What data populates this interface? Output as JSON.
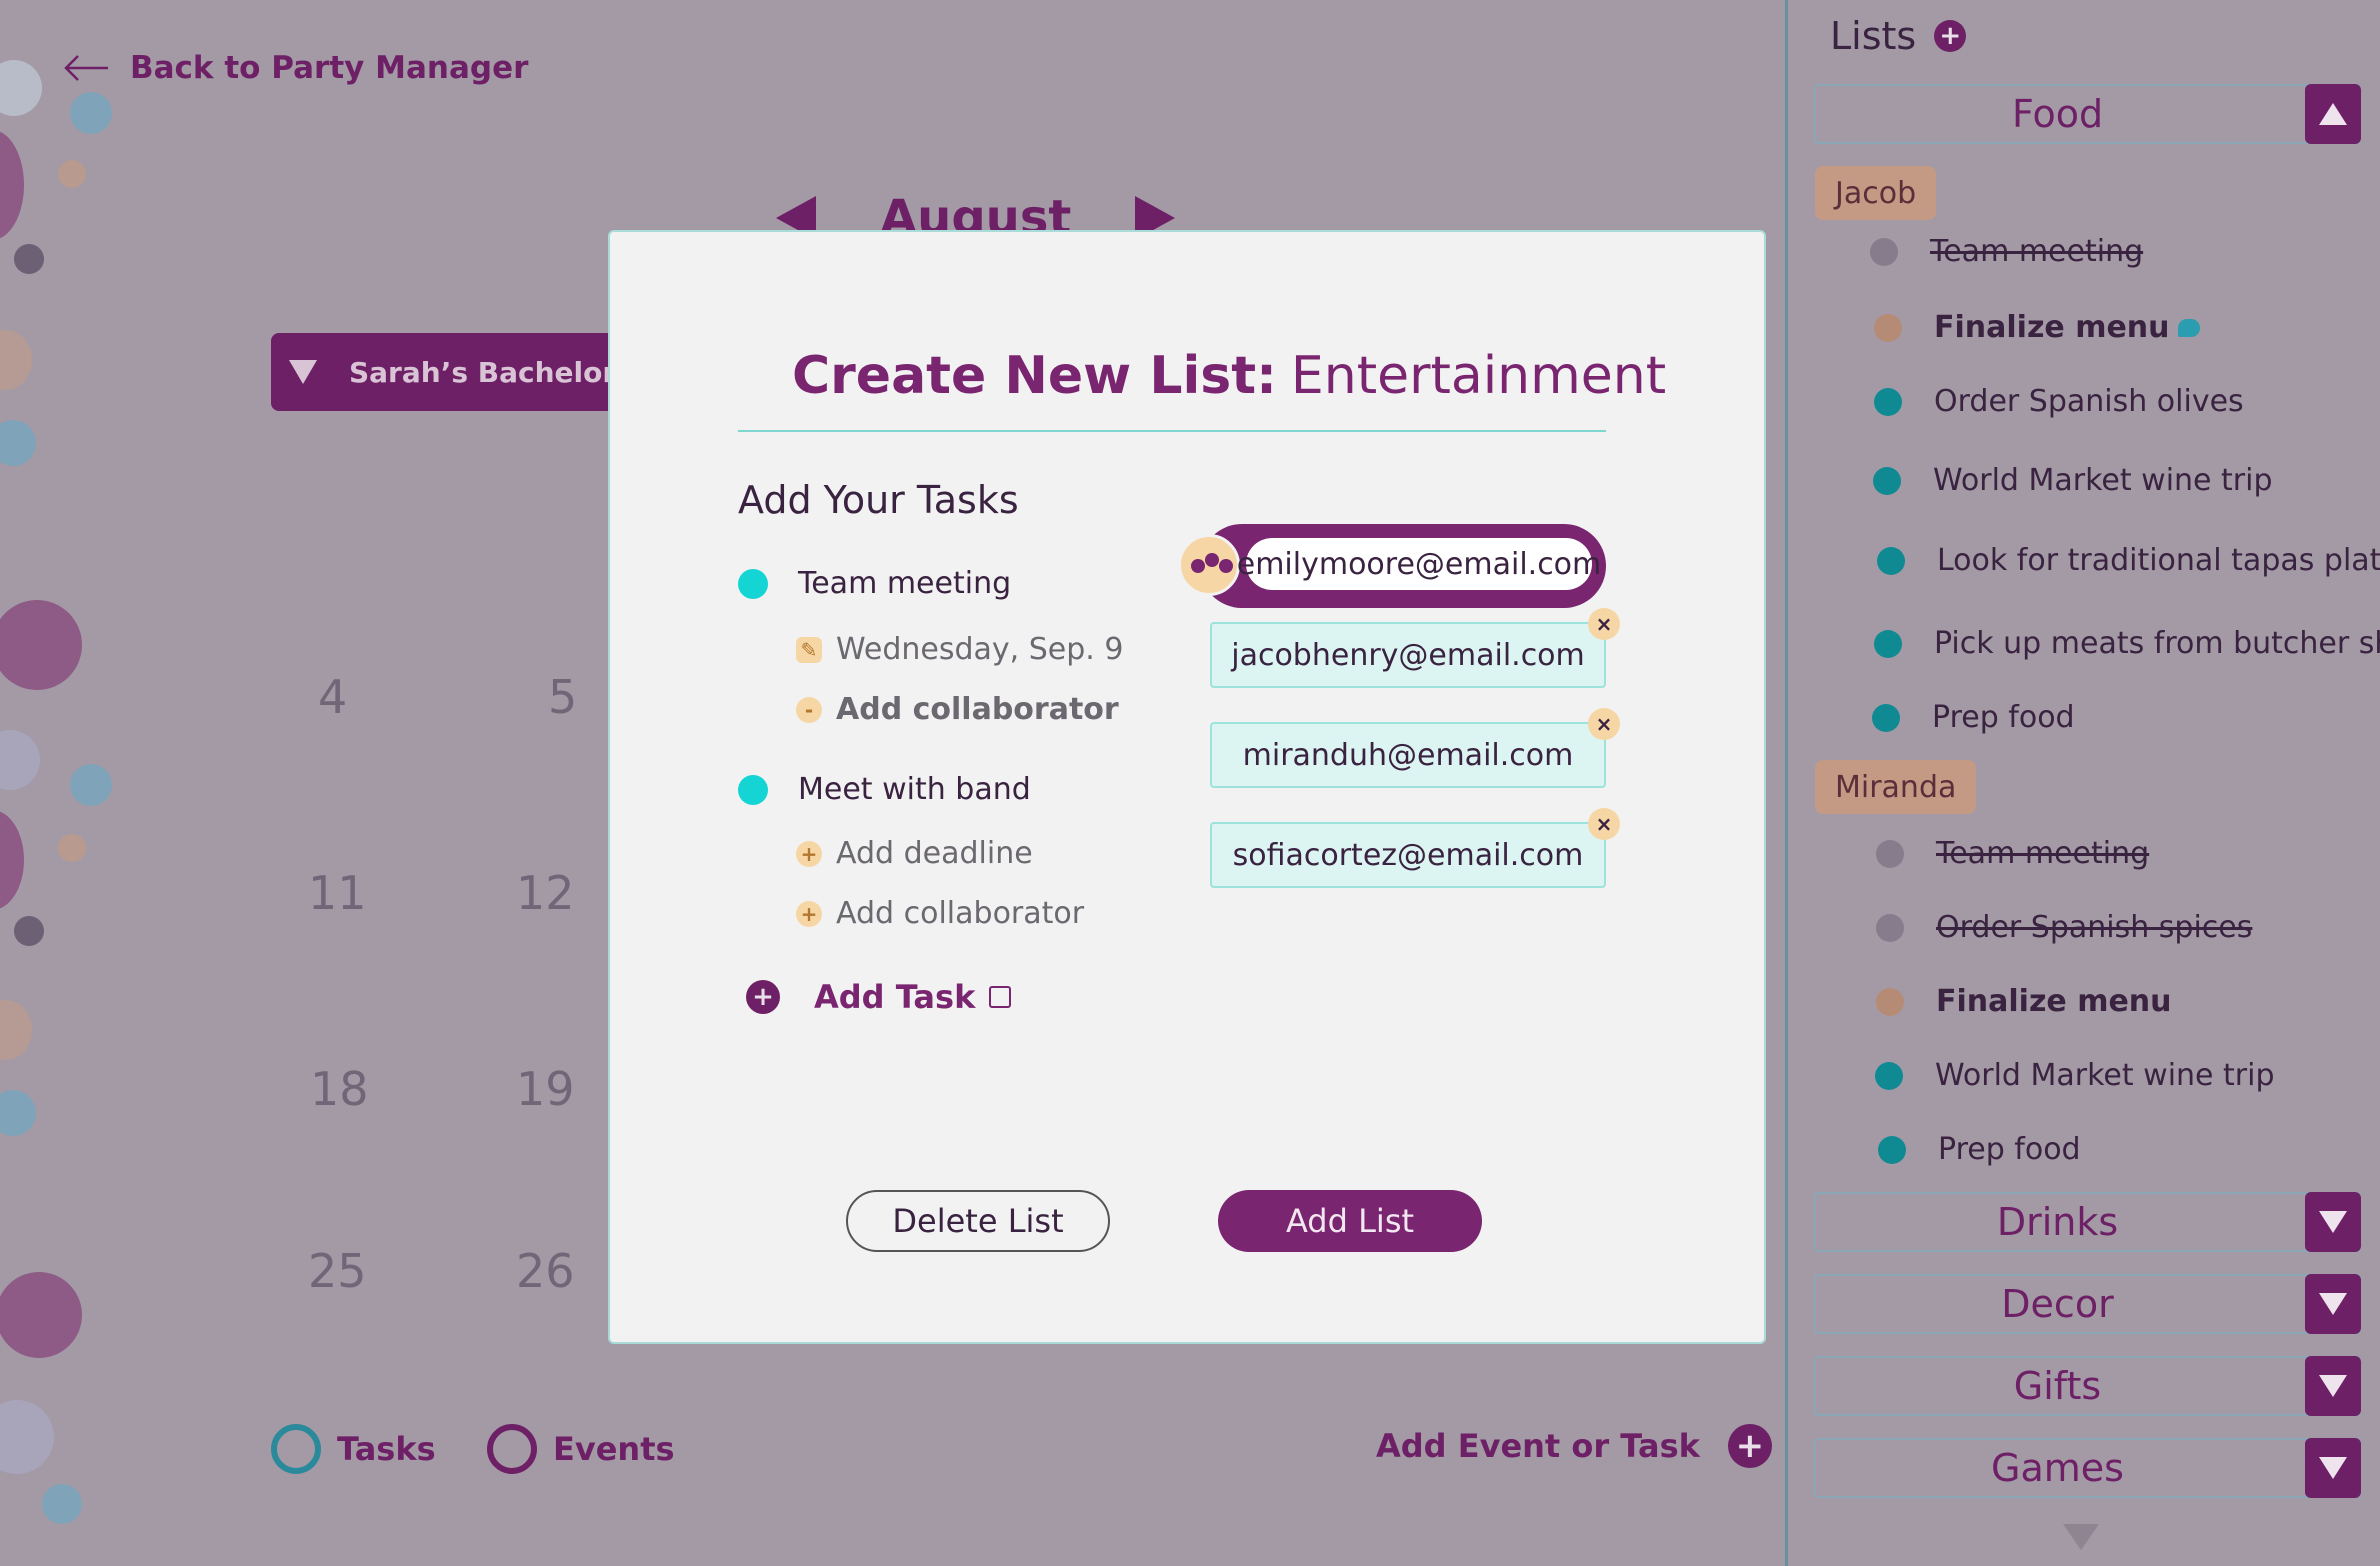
{
  "header": {
    "back_label": "Back to Party Manager"
  },
  "calendar": {
    "month": "August",
    "party_name": "Sarah’s Bachelorett",
    "days": [
      "4",
      "5",
      "11",
      "12",
      "18",
      "19",
      "25",
      "26"
    ]
  },
  "legend": {
    "tasks_label": "Tasks",
    "events_label": "Events"
  },
  "add_event_label": "Add Event or Task",
  "sidebar": {
    "title": "Lists",
    "lists": {
      "food": "Food",
      "drinks": "Drinks",
      "decor": "Decor",
      "gifts": "Gifts",
      "games": "Games"
    },
    "people": {
      "jacob": "Jacob",
      "miranda": "Miranda"
    },
    "jacob_items": [
      "Team meeting",
      "Finalize menu",
      "Order Spanish olives",
      "World Market wine trip",
      "Look for traditional tapas plates",
      "Pick up meats from butcher shop",
      "Prep food"
    ],
    "miranda_items": [
      "Team meeting",
      "Order Spanish spices",
      "Finalize menu",
      "World Market wine trip",
      "Prep food"
    ]
  },
  "modal": {
    "title_strong": "Create New List:",
    "title_name": "Entertainment",
    "section_label": "Add Your Tasks",
    "task1": {
      "name": "Team meeting",
      "date": "Wednesday, Sep. 9",
      "collab": "Add collaborator"
    },
    "task2": {
      "name": "Meet with band",
      "deadline": "Add deadline",
      "collab": "Add collaborator"
    },
    "add_task_label": "Add Task",
    "collaborators": {
      "active": "emilymoore@email.com",
      "list": [
        "jacobhenry@email.com",
        "miranduh@email.com",
        "sofiacortez@email.com"
      ]
    },
    "delete_label": "Delete List",
    "add_label": "Add List"
  },
  "colors": {
    "brand": "#6e2066",
    "teal": "#14d4d4",
    "tan": "#c49a85"
  }
}
